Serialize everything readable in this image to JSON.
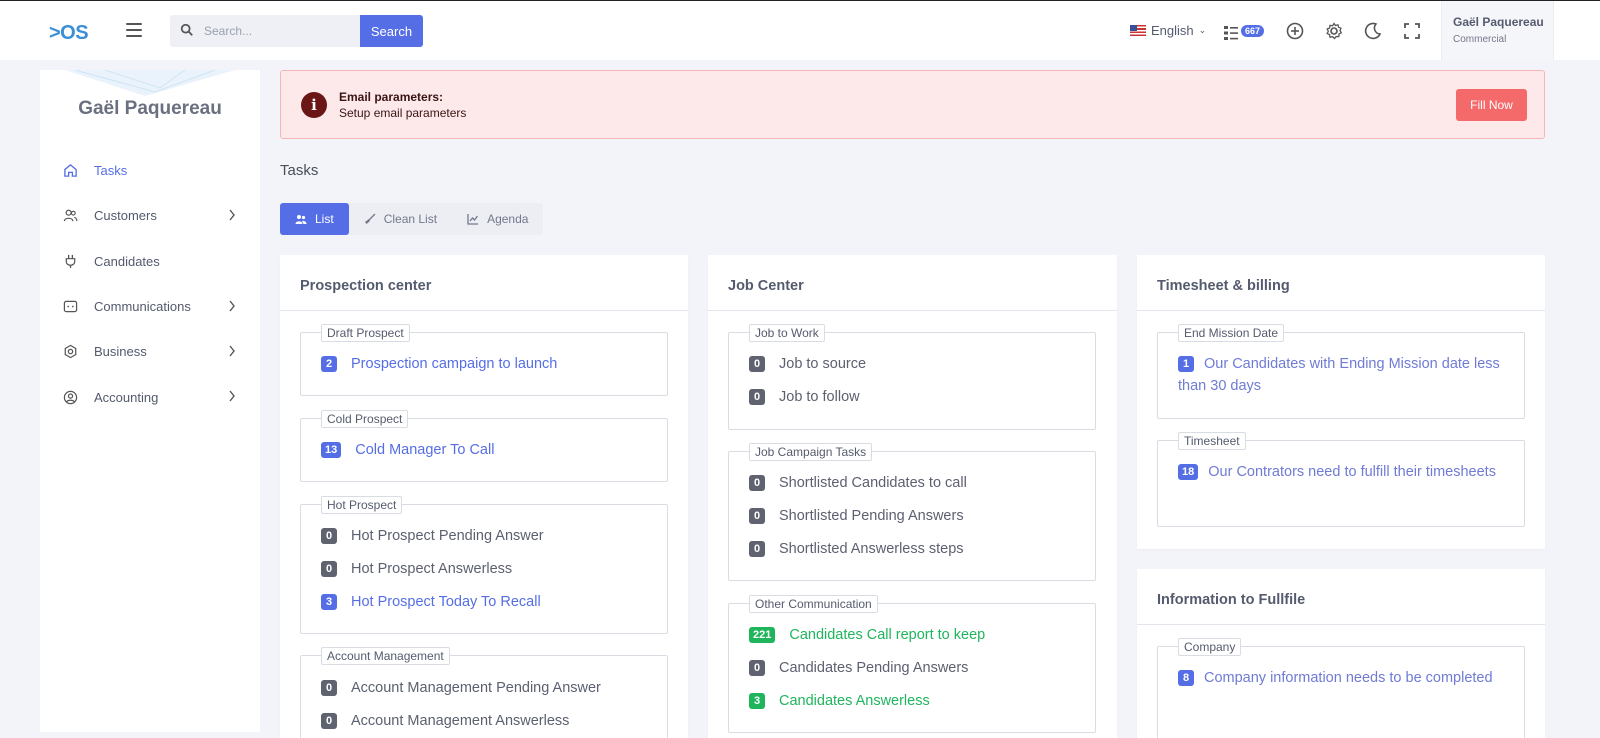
{
  "header": {
    "logo": ">OS",
    "search": {
      "placeholder": "Search...",
      "button": "Search"
    },
    "language": "English",
    "notification_count": "667",
    "user": {
      "name": "Gaël Paquereau",
      "role": "Commercial"
    }
  },
  "sidebar": {
    "title": "Gaël Paquereau",
    "items": [
      {
        "label": "Tasks",
        "icon": "home-icon",
        "active": true
      },
      {
        "label": "Customers",
        "icon": "users-icon",
        "has_submenu": true
      },
      {
        "label": "Candidates",
        "icon": "plug-icon"
      },
      {
        "label": "Communications",
        "icon": "chat-icon",
        "has_submenu": true
      },
      {
        "label": "Business",
        "icon": "gear-icon",
        "has_submenu": true
      },
      {
        "label": "Accounting",
        "icon": "user-circle-icon",
        "has_submenu": true
      }
    ]
  },
  "alert": {
    "title": "Email parameters:",
    "message": "Setup email parameters",
    "button": "Fill Now",
    "icon": "i"
  },
  "page_title": "Tasks",
  "tabs": [
    {
      "label": "List",
      "active": true
    },
    {
      "label": "Clean List"
    },
    {
      "label": "Agenda"
    }
  ],
  "cards": {
    "prospection": {
      "title": "Prospection center",
      "groups": [
        {
          "legend": "Draft Prospect",
          "rows": [
            {
              "count": "2",
              "label": "Prospection campaign to launch"
            }
          ]
        },
        {
          "legend": "Cold Prospect",
          "rows": [
            {
              "count": "13",
              "label": "Cold Manager To Call"
            }
          ]
        },
        {
          "legend": "Hot Prospect",
          "rows": [
            {
              "count": "0",
              "label": "Hot Prospect Pending Answer"
            },
            {
              "count": "0",
              "label": "Hot Prospect Answerless"
            },
            {
              "count": "3",
              "label": "Hot Prospect Today To Recall"
            }
          ]
        },
        {
          "legend": "Account Management",
          "rows": [
            {
              "count": "0",
              "label": "Account Management Pending Answer"
            },
            {
              "count": "0",
              "label": "Account Management Answerless"
            }
          ]
        }
      ]
    },
    "job": {
      "title": "Job Center",
      "groups": [
        {
          "legend": "Job to Work",
          "rows": [
            {
              "count": "0",
              "label": "Job to source"
            },
            {
              "count": "0",
              "label": "Job to follow"
            }
          ]
        },
        {
          "legend": "Job Campaign Tasks",
          "rows": [
            {
              "count": "0",
              "label": "Shortlisted Candidates to call"
            },
            {
              "count": "0",
              "label": "Shortlisted Pending Answers"
            },
            {
              "count": "0",
              "label": "Shortlisted Answerless steps"
            }
          ]
        },
        {
          "legend": "Other Communication",
          "rows": [
            {
              "count": "221",
              "label": "Candidates Call report to keep"
            },
            {
              "count": "0",
              "label": "Candidates Pending Answers"
            },
            {
              "count": "3",
              "label": "Candidates Answerless"
            }
          ]
        }
      ]
    },
    "timesheet": {
      "title": "Timesheet & billing",
      "groups": [
        {
          "legend": "End Mission Date",
          "rows": [
            {
              "count": "1",
              "label": "Our Candidates with Ending Mission date less than 30 days"
            }
          ]
        },
        {
          "legend": "Timesheet",
          "rows": [
            {
              "count": "18",
              "label": "Our Contrators need to fulfill their timesheets"
            }
          ]
        }
      ]
    },
    "info": {
      "title": "Information to Fullfile",
      "groups": [
        {
          "legend": "Company",
          "rows": [
            {
              "count": "8",
              "label": "Company information needs to be completed"
            }
          ]
        }
      ]
    }
  },
  "colors": {
    "primary": "#556ee6",
    "danger": "#f46a6a",
    "success": "#1fb55d",
    "muted": "#5f6370"
  }
}
